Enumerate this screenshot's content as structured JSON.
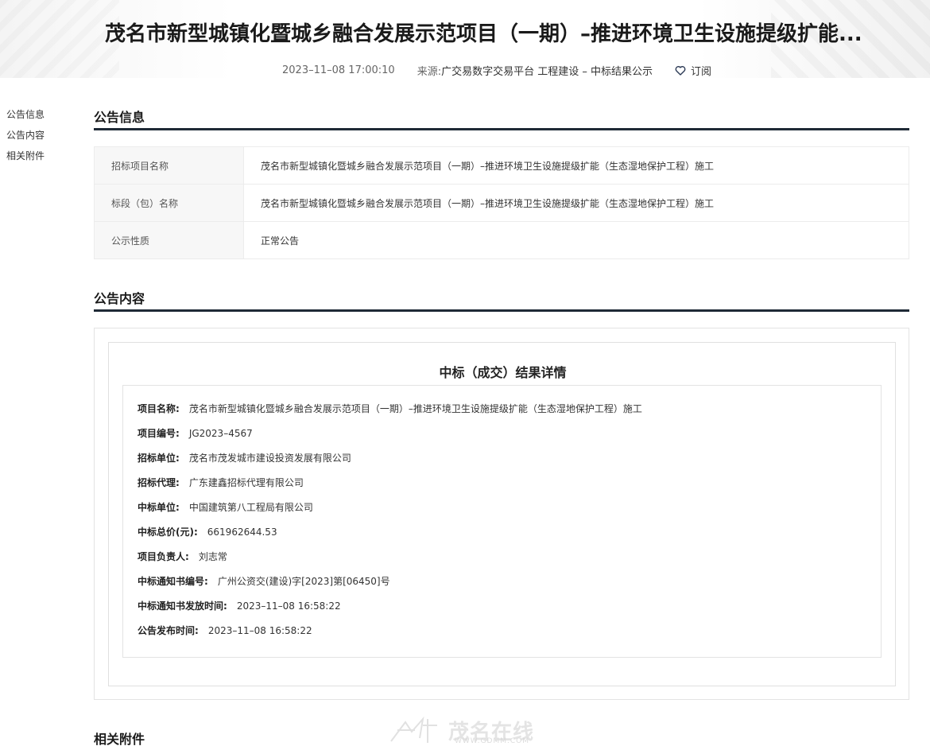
{
  "header": {
    "title": "茂名市新型城镇化暨城乡融合发展示范项目（一期）–推进环境卫生设施提级扩能...",
    "datetime": "2023–11–08 17:00:10",
    "source_label": "来源:",
    "source": "广交易数字交易平台 工程建设 – 中标结果公示",
    "subscribe_label": "订阅"
  },
  "side_nav": {
    "items": [
      "公告信息",
      "公告内容",
      "相关附件"
    ]
  },
  "sections": {
    "info_title": "公告信息",
    "content_title": "公告内容",
    "attachments_title": "相关附件"
  },
  "info_table": {
    "rows": [
      {
        "label": "招标项目名称",
        "value": "茂名市新型城镇化暨城乡融合发展示范项目（一期）–推进环境卫生设施提级扩能（生态湿地保护工程）施工"
      },
      {
        "label": "标段（包）名称",
        "value": "茂名市新型城镇化暨城乡融合发展示范项目（一期）–推进环境卫生设施提级扩能（生态湿地保护工程）施工"
      },
      {
        "label": "公示性质",
        "value": "正常公告"
      }
    ]
  },
  "result": {
    "title": "中标（成交）结果详情",
    "fields": [
      {
        "key": "项目名称:",
        "value": "茂名市新型城镇化暨城乡融合发展示范项目（一期）–推进环境卫生设施提级扩能（生态湿地保护工程）施工"
      },
      {
        "key": "项目编号:",
        "value": "JG2023–4567"
      },
      {
        "key": "招标单位:",
        "value": "茂名市茂发城市建设投资发展有限公司"
      },
      {
        "key": "招标代理:",
        "value": "广东建鑫招标代理有限公司"
      },
      {
        "key": "中标单位:",
        "value": "中国建筑第八工程局有限公司"
      },
      {
        "key": "中标总价(元):",
        "value": "661962644.53"
      },
      {
        "key": "项目负责人:",
        "value": "刘志常"
      },
      {
        "key": "中标通知书编号:",
        "value": "广州公资交(建设)字[2023]第[06450]号"
      },
      {
        "key": "中标通知书发放时间:",
        "value": "2023–11–08 16:58:22"
      },
      {
        "key": "公告发布时间:",
        "value": "2023–11–08 16:58:22"
      }
    ]
  },
  "watermark": {
    "text": "茂名在线",
    "url": "WWW.GDMM.COM"
  },
  "icons": {
    "subscribe": "heart-outline-icon",
    "watermark_logo": "star-logo-icon"
  },
  "colors": {
    "section_underline": "#1f2a36",
    "label_bg": "#f7f7f7"
  }
}
